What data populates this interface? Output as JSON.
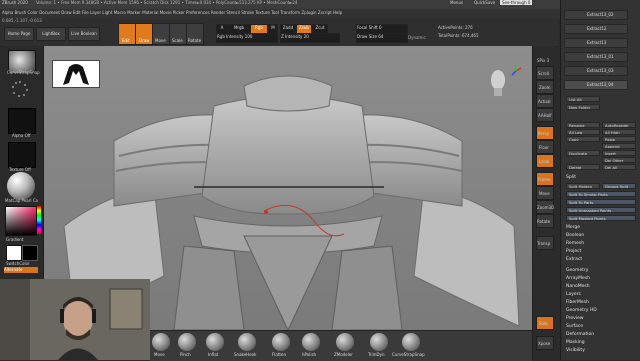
{
  "menubar": {
    "app_title": "ZBrush 2020",
    "status": "Volume: 1  • Free Mem 9.348GB • Active Mem 1596 • Scratch Disk 1291 • Timer►0.034 • PolyCount►513.275 KP • MeshCount►24",
    "menus": [
      "Alpha",
      "Brush",
      "Color",
      "Document",
      "Draw",
      "Edit",
      "File",
      "Layer",
      "Light",
      "Macro",
      "Marker",
      "Material",
      "Movie",
      "Picker",
      "Preferences",
      "Render",
      "Stencil",
      "Stroke",
      "Texture",
      "Tool",
      "Transform",
      "Zplugin",
      "Zscript",
      "Help"
    ],
    "quicksave": "QuickSave",
    "seethrough": "See-through 0",
    "menus_label": "Menus",
    "default_script": "DefaultZScript",
    "coords": "0.685,-1.307,-0.613"
  },
  "toolbar": {
    "home_page": "Home Page",
    "lightbox": "LightBox",
    "live_boolean": "Live Boolean",
    "edit": "Edit",
    "draw": "Draw",
    "move": "Move",
    "scale": "Scale",
    "rotate": "Rotate",
    "a_label": "A",
    "mrgb": "Mrgb",
    "rgb": "Rgb",
    "m_label": "M",
    "zadd": "Zadd",
    "zsub": "Zsub",
    "zcut": "Zcut",
    "rgb_intensity": "Rgb Intensity 100",
    "z_intensity": "Z Intensity 20",
    "focal_shift": "Focal Shift 0",
    "draw_size": "Draw Size 64",
    "dynamic": "Dynamic",
    "active_points": "ActivePoints: 276",
    "total_points": "TotalPoints: 674,465"
  },
  "lefttray": {
    "brush_label": "CurveStrapSnap",
    "alpha_label": "Alpha Off",
    "texture_label": "Texture Off",
    "material_label": "MatCap Pearl Ca",
    "gradient_label": "Gradient",
    "switch_color": "SwitchColor",
    "alternate": "Alternate"
  },
  "bottomshelf": {
    "brushes": [
      "Move",
      "Pinch",
      "Inflat",
      "SnakeHook",
      "Flatten",
      "hPolish",
      "ZModeler",
      "TrimDyn",
      "CurveStrapSnap"
    ]
  },
  "rightshelf": {
    "spix": "SPix 3",
    "buttons": [
      "Scroll",
      "Zoom",
      "Actual",
      "AAHalf",
      "Persp",
      "Floor",
      "Local",
      "Frame",
      "Move",
      "Zoom3D",
      "Rotate",
      "Transp",
      "Solo",
      "Xpose"
    ]
  },
  "rightpanel": {
    "subtools": [
      "Extract13_02",
      "Extract12",
      "Extract13",
      "Extract13_01",
      "Extract13_03",
      "Extract13_04"
    ],
    "list_all": "List All",
    "new_folder": "New Folder",
    "rename": "Rename",
    "autoreorder": "AutoReorder",
    "all_low": "All Low",
    "all_high": "All High",
    "copy": "Copy",
    "paste": "Paste",
    "append": "Append",
    "duplicate": "Duplicate",
    "insert": "Insert",
    "del_other": "Del Other",
    "delete": "Delete",
    "del_all": "Del All",
    "split_header": "Split",
    "split_hidden": "Split Hidden",
    "groups_split": "Groups Split",
    "split_similar": "Split To Similar Parts",
    "split_parts": "Split To Parts",
    "split_unmasked": "Split Unmasked Points",
    "split_masked": "Split Masked Points",
    "merge": "Merge",
    "boolean": "Boolean",
    "remesh": "Remesh",
    "project": "Project",
    "extract": "Extract",
    "sections": [
      "Geometry",
      "ArrayMesh",
      "NanoMesh",
      "Layers",
      "FiberMesh",
      "Geometry HD",
      "Preview",
      "Surface",
      "Deformation",
      "Masking",
      "Visibility"
    ]
  }
}
